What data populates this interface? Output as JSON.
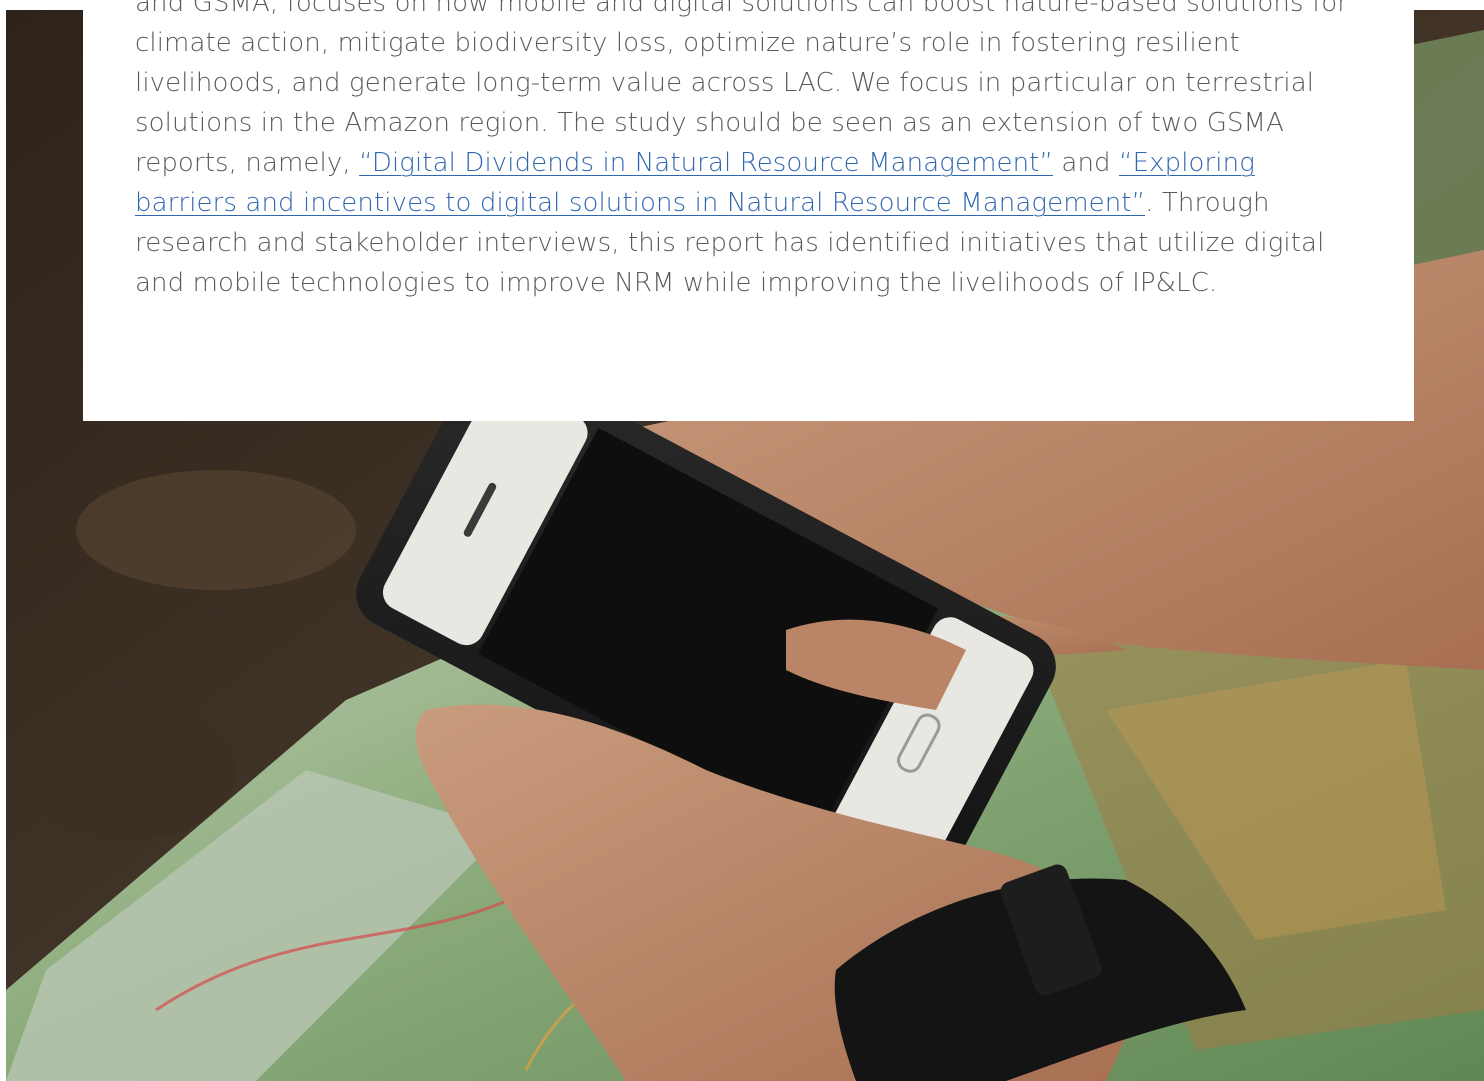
{
  "content": {
    "intro_before_link_1": "and GSMA, focuses on how mobile and digital solutions can boost nature-based solutions for climate action, mitigate biodiversity loss, optimize nature’s role in fostering resilient livelihoods, and generate long-term value across LAC. We focus in particular on terrestrial solutions in the Amazon region. The study should be seen as an extension of two GSMA reports, namely,  ",
    "link_1": "“Digital Dividends in Natural Resource Management”",
    "between_links": " and ",
    "link_2": "“Exploring barriers and incentives to digital solutions in Natural Resource Management”",
    "intro_after_link_2": ". Through research and stakeholder interviews, this report has identified initiatives that utilize digital and mobile technologies to improve NRM while improving the livelihoods of IP&LC."
  },
  "colors": {
    "body_text": "#5a5a5a",
    "link": "#2f66b0",
    "card_background": "#ffffff"
  }
}
